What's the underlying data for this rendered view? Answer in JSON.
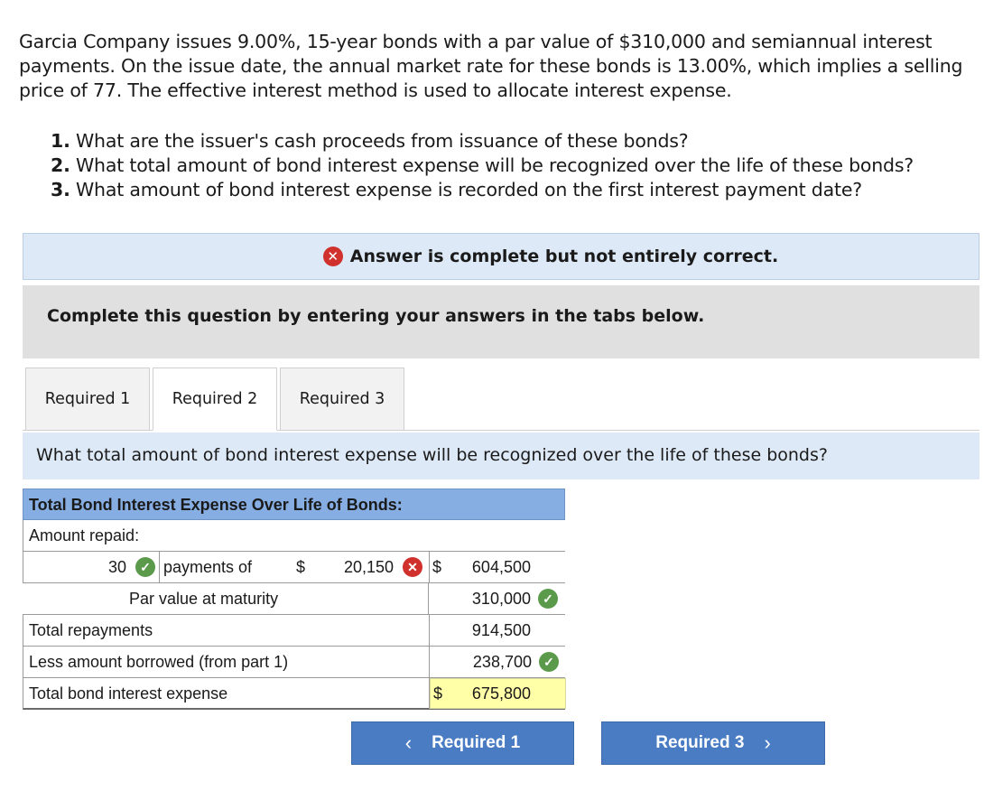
{
  "problem": {
    "intro": "Garcia Company issues 9.00%, 15-year bonds with a par value of $310,000 and semiannual interest payments. On the issue date, the annual market rate for these bonds is 13.00%, which implies a selling price of 77. The effective interest method is used to allocate interest expense.",
    "questions": [
      {
        "num": "1.",
        "text": "What are the issuer's cash proceeds from issuance of these bonds?"
      },
      {
        "num": "2.",
        "text": "What total amount of bond interest expense will be recognized over the life of these bonds?"
      },
      {
        "num": "3.",
        "text": "What amount of bond interest expense is recorded on the first interest payment date?"
      }
    ]
  },
  "status": {
    "text": "Answer is complete but not entirely correct.",
    "icon": "x-circle-icon",
    "color": "#d0312d"
  },
  "instructions": "Complete this question by entering your answers in the tabs below.",
  "tabs": [
    {
      "label": "Required 1",
      "active": false
    },
    {
      "label": "Required 2",
      "active": true
    },
    {
      "label": "Required 3",
      "active": false
    }
  ],
  "question_bar": "What total amount of bond interest expense will be recognized over the life of these bonds?",
  "table": {
    "title": "Total Bond Interest Expense Over Life of Bonds:",
    "amount_repaid_label": "Amount repaid:",
    "payments_count": "30",
    "payments_of_label": "payments of",
    "dollar": "$",
    "payment_amount": "20,150",
    "payments_total": "604,500",
    "par_label": "Par value at maturity",
    "par_value": "310,000",
    "total_repayments_label": "Total repayments",
    "total_repayments": "914,500",
    "less_borrowed_label": "Less amount borrowed (from part 1)",
    "less_borrowed": "238,700",
    "total_expense_label": "Total bond interest expense",
    "total_expense": "675,800"
  },
  "nav": {
    "prev_label": "Required 1",
    "next_label": "Required 3",
    "prev_icon": "chevron-left-icon",
    "next_icon": "chevron-right-icon"
  },
  "colors": {
    "check": "#5a9a4a",
    "error": "#d0312d",
    "header": "#86aee3",
    "button": "#4a7cc4",
    "highlight": "#ffffa8"
  }
}
